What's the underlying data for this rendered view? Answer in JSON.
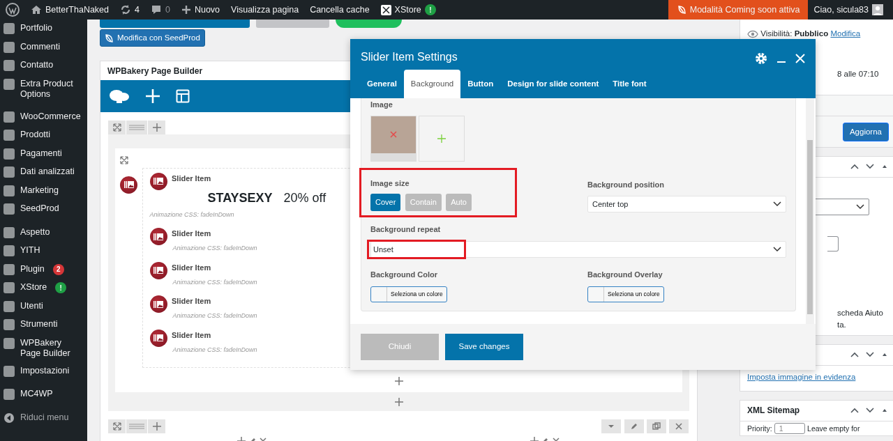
{
  "admin_bar": {
    "site": "BetterThaNaked",
    "updates": "4",
    "comments": "0",
    "new": "Nuovo",
    "view": "Visualizza pagina",
    "clear_cache": "Cancella cache",
    "xstore": "XStore",
    "xstore_badge": "!",
    "coming_soon": "Modalità Coming soon attiva",
    "greeting": "Ciao, sicula83"
  },
  "sidebar": {
    "groups": [
      [
        {
          "label": "Portfolio"
        },
        {
          "label": "Commenti"
        },
        {
          "label": "Contatto"
        },
        {
          "label": "Extra Product Options"
        }
      ],
      [
        {
          "label": "WooCommerce"
        },
        {
          "label": "Prodotti"
        },
        {
          "label": "Pagamenti"
        },
        {
          "label": "Dati analizzati"
        },
        {
          "label": "Marketing"
        },
        {
          "label": "SeedProd"
        }
      ],
      [
        {
          "label": "Aspetto"
        },
        {
          "label": "YITH"
        },
        {
          "label": "Plugin",
          "badge": {
            "text": "2",
            "color": "#d63638"
          }
        },
        {
          "label": "XStore",
          "badge": {
            "text": "!",
            "color": "#1fa045"
          }
        },
        {
          "label": "Utenti"
        },
        {
          "label": "Strumenti"
        },
        {
          "label": "WPBakery Page Builder"
        },
        {
          "label": "Impostazioni"
        }
      ],
      [
        {
          "label": "MC4WP"
        }
      ]
    ],
    "collapse": "Riduci menu"
  },
  "seedprod_button": "Modifica con SeedProd",
  "builder": {
    "title": "WPBakery Page Builder",
    "slider_items": [
      {
        "title": "Slider Item",
        "heading": "STAYSEXY",
        "subheading": "20% off",
        "note": "Animazione CSS: fadeInDown"
      },
      {
        "title": "Slider Item",
        "note": "Animazione CSS: fadeInDown"
      },
      {
        "title": "Slider Item",
        "note": "Animazione CSS: fadeInDown"
      },
      {
        "title": "Slider Item",
        "note": "Animazione CSS: fadeInDown"
      },
      {
        "title": "Slider Item",
        "note": "Animazione CSS: fadeInDown"
      }
    ]
  },
  "right_panel": {
    "visibility_label": "Visibilità:",
    "visibility_value": "Pubblico",
    "visibility_link": "Modifica",
    "date_fragment": "8 alle 07:10",
    "update_button": "Aggiorna",
    "help_fragment_1": "scheda Aiuto",
    "help_fragment_2": "ta.",
    "featured_link": "Imposta immagine in evidenza",
    "sitemap_title": "XML Sitemap",
    "priority_label": "Priority:",
    "priority_value": "1",
    "priority_hint": "Leave empty for"
  },
  "modal": {
    "title": "Slider Item Settings",
    "tabs": [
      {
        "label": "General",
        "selected": false
      },
      {
        "label": "Background",
        "selected": true
      },
      {
        "label": "Button",
        "selected": false
      },
      {
        "label": "Design for slide content",
        "selected": false
      },
      {
        "label": "Title font",
        "selected": false
      }
    ],
    "image_label": "Image",
    "image_size": {
      "label": "Image size",
      "highlighted": true,
      "options": [
        {
          "label": "Cover",
          "selected": true
        },
        {
          "label": "Contain",
          "selected": false
        },
        {
          "label": "Auto",
          "selected": false
        }
      ]
    },
    "background_position": {
      "label": "Background position",
      "value": "Center top"
    },
    "background_repeat": {
      "label": "Background repeat",
      "value": "Unset",
      "highlighted": true
    },
    "background_color": {
      "label": "Background Color",
      "button": "Seleziona un colore"
    },
    "background_overlay": {
      "label": "Background Overlay",
      "button": "Seleziona un colore"
    },
    "close_button": "Chiudi",
    "save_button": "Save changes"
  }
}
